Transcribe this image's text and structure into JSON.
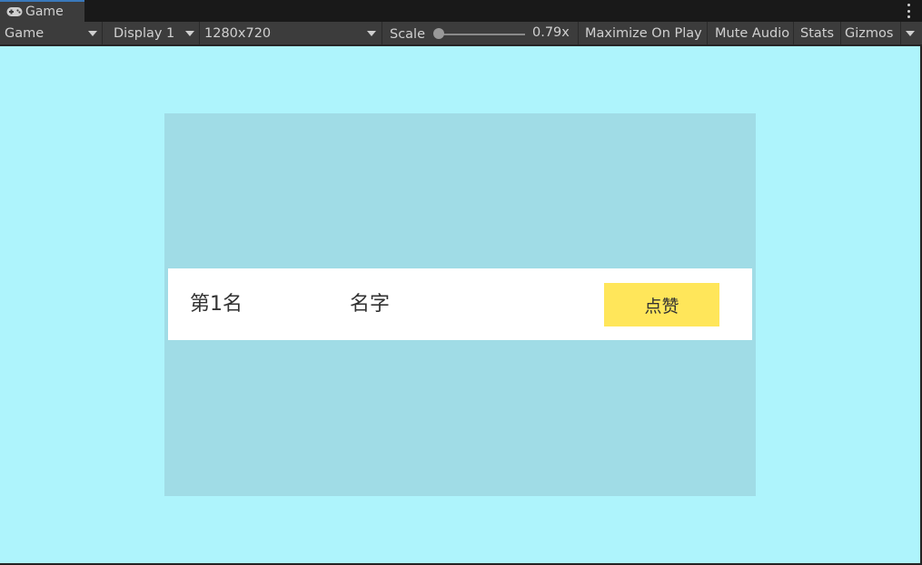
{
  "tab": {
    "label": "Game",
    "icon": "gamepad-icon"
  },
  "toolbar": {
    "view_mode": "Game",
    "display": "Display 1",
    "resolution": "1280x720",
    "scale_label": "Scale",
    "scale_value": "0.79x",
    "maximize": "Maximize On Play",
    "mute": "Mute Audio",
    "stats": "Stats",
    "gizmos": "Gizmos"
  },
  "colors": {
    "game_background": "#aef4fc",
    "panel": "#a0dce6",
    "row": "#ffffff",
    "button": "#ffe65a",
    "text": "#323232"
  },
  "leaderboard": {
    "rank": "第1名",
    "name": "名字",
    "like_button": "点赞"
  }
}
